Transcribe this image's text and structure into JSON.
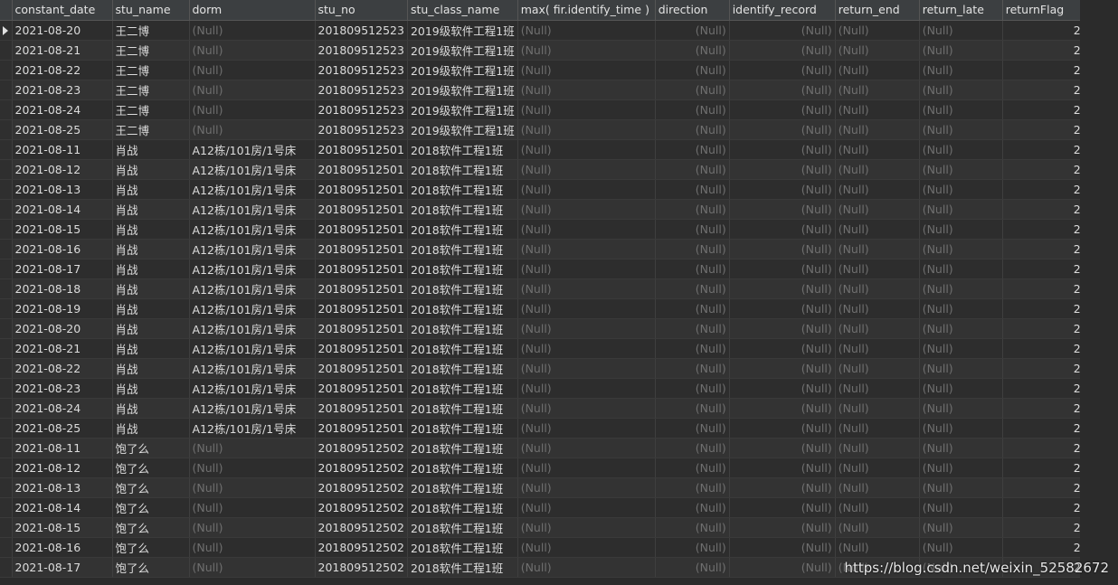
{
  "columns": [
    {
      "key": "constant_date",
      "label": "constant_date"
    },
    {
      "key": "stu_name",
      "label": "stu_name"
    },
    {
      "key": "dorm",
      "label": "dorm"
    },
    {
      "key": "stu_no",
      "label": "stu_no"
    },
    {
      "key": "stu_class_name",
      "label": "stu_class_name"
    },
    {
      "key": "max_identify_time",
      "label": "max( fir.identify_time )"
    },
    {
      "key": "direction",
      "label": "direction"
    },
    {
      "key": "identify_record",
      "label": "identify_record"
    },
    {
      "key": "return_end",
      "label": "return_end"
    },
    {
      "key": "return_late",
      "label": "return_late"
    },
    {
      "key": "returnFlag",
      "label": "returnFlag"
    }
  ],
  "null_text": "(Null)",
  "rows": [
    [
      "2021-08-20",
      "王二博",
      "(Null)",
      "201809512523",
      "2019级软件工程1班",
      "(Null)",
      "(Null)",
      "(Null)",
      "(Null)",
      "(Null)",
      "2"
    ],
    [
      "2021-08-21",
      "王二博",
      "(Null)",
      "201809512523",
      "2019级软件工程1班",
      "(Null)",
      "(Null)",
      "(Null)",
      "(Null)",
      "(Null)",
      "2"
    ],
    [
      "2021-08-22",
      "王二博",
      "(Null)",
      "201809512523",
      "2019级软件工程1班",
      "(Null)",
      "(Null)",
      "(Null)",
      "(Null)",
      "(Null)",
      "2"
    ],
    [
      "2021-08-23",
      "王二博",
      "(Null)",
      "201809512523",
      "2019级软件工程1班",
      "(Null)",
      "(Null)",
      "(Null)",
      "(Null)",
      "(Null)",
      "2"
    ],
    [
      "2021-08-24",
      "王二博",
      "(Null)",
      "201809512523",
      "2019级软件工程1班",
      "(Null)",
      "(Null)",
      "(Null)",
      "(Null)",
      "(Null)",
      "2"
    ],
    [
      "2021-08-25",
      "王二博",
      "(Null)",
      "201809512523",
      "2019级软件工程1班",
      "(Null)",
      "(Null)",
      "(Null)",
      "(Null)",
      "(Null)",
      "2"
    ],
    [
      "2021-08-11",
      "肖战",
      "A12栋/101房/1号床",
      "201809512501",
      "2018软件工程1班",
      "(Null)",
      "(Null)",
      "(Null)",
      "(Null)",
      "(Null)",
      "2"
    ],
    [
      "2021-08-12",
      "肖战",
      "A12栋/101房/1号床",
      "201809512501",
      "2018软件工程1班",
      "(Null)",
      "(Null)",
      "(Null)",
      "(Null)",
      "(Null)",
      "2"
    ],
    [
      "2021-08-13",
      "肖战",
      "A12栋/101房/1号床",
      "201809512501",
      "2018软件工程1班",
      "(Null)",
      "(Null)",
      "(Null)",
      "(Null)",
      "(Null)",
      "2"
    ],
    [
      "2021-08-14",
      "肖战",
      "A12栋/101房/1号床",
      "201809512501",
      "2018软件工程1班",
      "(Null)",
      "(Null)",
      "(Null)",
      "(Null)",
      "(Null)",
      "2"
    ],
    [
      "2021-08-15",
      "肖战",
      "A12栋/101房/1号床",
      "201809512501",
      "2018软件工程1班",
      "(Null)",
      "(Null)",
      "(Null)",
      "(Null)",
      "(Null)",
      "2"
    ],
    [
      "2021-08-16",
      "肖战",
      "A12栋/101房/1号床",
      "201809512501",
      "2018软件工程1班",
      "(Null)",
      "(Null)",
      "(Null)",
      "(Null)",
      "(Null)",
      "2"
    ],
    [
      "2021-08-17",
      "肖战",
      "A12栋/101房/1号床",
      "201809512501",
      "2018软件工程1班",
      "(Null)",
      "(Null)",
      "(Null)",
      "(Null)",
      "(Null)",
      "2"
    ],
    [
      "2021-08-18",
      "肖战",
      "A12栋/101房/1号床",
      "201809512501",
      "2018软件工程1班",
      "(Null)",
      "(Null)",
      "(Null)",
      "(Null)",
      "(Null)",
      "2"
    ],
    [
      "2021-08-19",
      "肖战",
      "A12栋/101房/1号床",
      "201809512501",
      "2018软件工程1班",
      "(Null)",
      "(Null)",
      "(Null)",
      "(Null)",
      "(Null)",
      "2"
    ],
    [
      "2021-08-20",
      "肖战",
      "A12栋/101房/1号床",
      "201809512501",
      "2018软件工程1班",
      "(Null)",
      "(Null)",
      "(Null)",
      "(Null)",
      "(Null)",
      "2"
    ],
    [
      "2021-08-21",
      "肖战",
      "A12栋/101房/1号床",
      "201809512501",
      "2018软件工程1班",
      "(Null)",
      "(Null)",
      "(Null)",
      "(Null)",
      "(Null)",
      "2"
    ],
    [
      "2021-08-22",
      "肖战",
      "A12栋/101房/1号床",
      "201809512501",
      "2018软件工程1班",
      "(Null)",
      "(Null)",
      "(Null)",
      "(Null)",
      "(Null)",
      "2"
    ],
    [
      "2021-08-23",
      "肖战",
      "A12栋/101房/1号床",
      "201809512501",
      "2018软件工程1班",
      "(Null)",
      "(Null)",
      "(Null)",
      "(Null)",
      "(Null)",
      "2"
    ],
    [
      "2021-08-24",
      "肖战",
      "A12栋/101房/1号床",
      "201809512501",
      "2018软件工程1班",
      "(Null)",
      "(Null)",
      "(Null)",
      "(Null)",
      "(Null)",
      "2"
    ],
    [
      "2021-08-25",
      "肖战",
      "A12栋/101房/1号床",
      "201809512501",
      "2018软件工程1班",
      "(Null)",
      "(Null)",
      "(Null)",
      "(Null)",
      "(Null)",
      "2"
    ],
    [
      "2021-08-11",
      "饱了么",
      "(Null)",
      "201809512502",
      "2018软件工程1班",
      "(Null)",
      "(Null)",
      "(Null)",
      "(Null)",
      "(Null)",
      "2"
    ],
    [
      "2021-08-12",
      "饱了么",
      "(Null)",
      "201809512502",
      "2018软件工程1班",
      "(Null)",
      "(Null)",
      "(Null)",
      "(Null)",
      "(Null)",
      "2"
    ],
    [
      "2021-08-13",
      "饱了么",
      "(Null)",
      "201809512502",
      "2018软件工程1班",
      "(Null)",
      "(Null)",
      "(Null)",
      "(Null)",
      "(Null)",
      "2"
    ],
    [
      "2021-08-14",
      "饱了么",
      "(Null)",
      "201809512502",
      "2018软件工程1班",
      "(Null)",
      "(Null)",
      "(Null)",
      "(Null)",
      "(Null)",
      "2"
    ],
    [
      "2021-08-15",
      "饱了么",
      "(Null)",
      "201809512502",
      "2018软件工程1班",
      "(Null)",
      "(Null)",
      "(Null)",
      "(Null)",
      "(Null)",
      "2"
    ],
    [
      "2021-08-16",
      "饱了么",
      "(Null)",
      "201809512502",
      "2018软件工程1班",
      "(Null)",
      "(Null)",
      "(Null)",
      "(Null)",
      "(Null)",
      "2"
    ],
    [
      "2021-08-17",
      "饱了么",
      "(Null)",
      "201809512502",
      "2018软件工程1班",
      "(Null)",
      "(Null)",
      "(Null)",
      "(Null)",
      "(Null)",
      "2"
    ]
  ],
  "numeric_columns": [
    "direction",
    "identify_record",
    "returnFlag"
  ],
  "selected_row": 0,
  "watermark": "https://blog.csdn.net/weixin_52582672"
}
